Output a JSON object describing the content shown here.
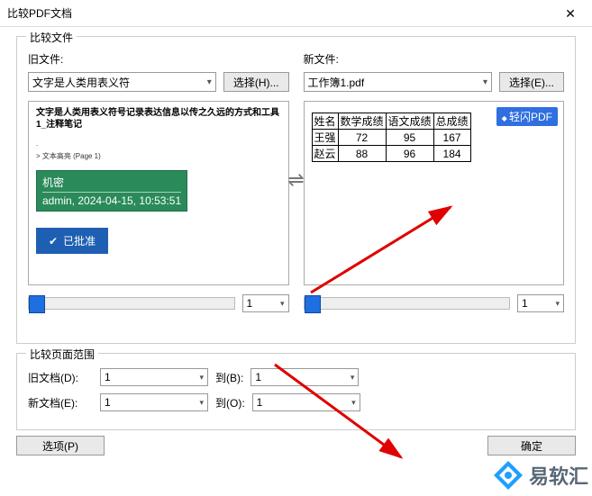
{
  "window": {
    "title": "比较PDF文档"
  },
  "group1": {
    "legend": "比较文件"
  },
  "old": {
    "label": "旧文件:",
    "combo": "文字是人类用表义符",
    "pick": "选择(H)...",
    "headline": "文字是人类用表义符号记录表达信息以传之久远的方式和工具 1_注释笔记",
    "meta1": ".",
    "meta2": "> 文本高亮 (Page 1)",
    "stamp_top": "机密",
    "stamp_bot": "admin, 2024-04-15, 10:53:51",
    "approved": "已批准",
    "page": "1"
  },
  "new": {
    "label": "新文件:",
    "combo": "工作簿1.pdf",
    "pick": "选择(E)...",
    "badge": "轻闪PDF",
    "page": "1",
    "table": {
      "h": [
        "姓名",
        "数学成绩",
        "语文成绩",
        "总成绩"
      ],
      "r1": [
        "王强",
        "72",
        "95",
        "167"
      ],
      "r2": [
        "赵云",
        "88",
        "96",
        "184"
      ]
    }
  },
  "group2": {
    "legend": "比较页面范围"
  },
  "range": {
    "old_label": "旧文档(D):",
    "new_label": "新文档(E):",
    "to_b": "到(B):",
    "to_o": "到(O):",
    "v": "1"
  },
  "buttons": {
    "options": "选项(P)",
    "ok": "确定"
  },
  "brand": "易软汇"
}
